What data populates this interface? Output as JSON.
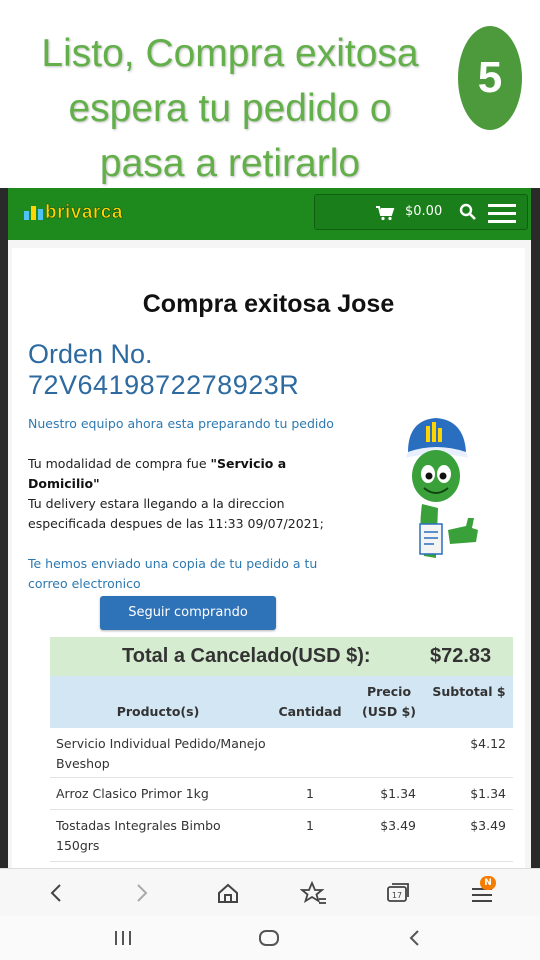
{
  "instruction": {
    "lines": [
      "Listo, Compra exitosa",
      "espera tu pedido o",
      "pasa a retirarlo"
    ],
    "step": "5"
  },
  "appbar": {
    "logo_text": "brivarca",
    "cart_total": "$0.00",
    "icons": [
      "cart-icon",
      "search-icon",
      "menu-icon"
    ]
  },
  "order": {
    "success_title": "Compra exitosa Jose",
    "order_label": "Orden No.",
    "order_number": "72V6419872278923R",
    "msg_preparing": "Nuestro equipo ahora esta preparando tu pedido",
    "msg_mode_prefix": "Tu modalidad de compra fue ",
    "msg_mode_value": "\"Servicio a Domicilio\"",
    "msg_delivery": "Tu delivery estara llegando a la direccion especificada despues de las 11:33 09/07/2021;",
    "msg_email": "Te hemos enviado una copia de tu pedido a tu correo electronico",
    "continue_button": "Seguir comprando"
  },
  "summary": {
    "total_label": "Total a Cancelado(USD $):",
    "total_value": "$72.83",
    "columns": {
      "product": "Producto(s)",
      "quantity": "Cantidad",
      "price": "Precio (USD $)",
      "subtotal": "Subtotal $"
    },
    "rows": [
      {
        "product": "Servicio Individual Pedido/Manejo Bveshop",
        "quantity": "",
        "price": "",
        "subtotal": "$4.12"
      },
      {
        "product": "Arroz Clasico Primor 1kg",
        "quantity": "1",
        "price": "$1.34",
        "subtotal": "$1.34"
      },
      {
        "product": "Tostadas Integrales Bimbo 150grs",
        "quantity": "1",
        "price": "$3.49",
        "subtotal": "$3.49"
      }
    ]
  },
  "browser_toolbar": {
    "icons": [
      "back-icon",
      "forward-icon",
      "home-icon",
      "bookmark-star-icon",
      "tabs-icon",
      "menu-icon"
    ],
    "tabs_count": "17",
    "menu_badge": "N"
  },
  "system_nav": {
    "icons": [
      "recents-icon",
      "home-circle-icon",
      "back-chevron-icon"
    ]
  },
  "colors": {
    "instruction_green": "#63b04a",
    "badge_green": "#4c9a3b",
    "appbar_green": "#1e8a1e",
    "logo_yellow": "#ffd400",
    "link_blue": "#2d6aa0",
    "button_blue": "#2e72b8",
    "total_bg": "#d6ecd0",
    "header_bg": "#d3e6f4"
  }
}
